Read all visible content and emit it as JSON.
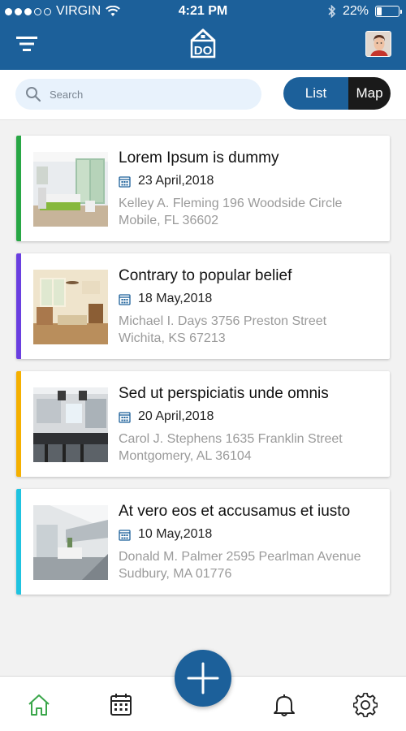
{
  "status_bar": {
    "carrier": "VIRGIN",
    "time": "4:21 PM",
    "battery": "22%",
    "battery_level": 0.22
  },
  "header": {
    "logo_text": "DO",
    "icons": [
      "menu-icon",
      "logo-icon",
      "avatar"
    ]
  },
  "search": {
    "placeholder": "Search"
  },
  "view_toggle": {
    "list_label": "List",
    "map_label": "Map",
    "selected": "List"
  },
  "tasks": [
    {
      "title": "Lorem Ipsum is dummy",
      "date": "23 April,2018",
      "address_line1": "Kelley A. Fleming 196 Woodside Circle",
      "address_line2": "Mobile, FL 36602",
      "accent": "#28a745"
    },
    {
      "title": "Contrary to popular belief",
      "date": "18 May,2018",
      "address_line1": "Michael I. Days 3756 Preston Street",
      "address_line2": "Wichita, KS 67213",
      "accent": "#6a3fe0"
    },
    {
      "title": "Sed ut perspiciatis unde omnis",
      "date": "20 April,2018",
      "address_line1": "Carol J. Stephens 1635 Franklin Street",
      "address_line2": "Montgomery, AL 36104",
      "accent": "#f5b000"
    },
    {
      "title": "At vero eos et accusamus et iusto",
      "date": "10 May,2018",
      "address_line1": "Donald M. Palmer 2595 Pearlman Avenue",
      "address_line2": "Sudbury, MA 01776",
      "accent": "#1fc3e0"
    }
  ],
  "bottom_nav": {
    "items": [
      "home-icon",
      "calendar-icon",
      "add-icon",
      "bell-icon",
      "settings-icon"
    ],
    "active": "home-icon",
    "active_color": "#3aa64a"
  },
  "colors": {
    "primary": "#1c609a",
    "dark": "#1a1a1a",
    "calendar_icon": "#1c609a"
  }
}
